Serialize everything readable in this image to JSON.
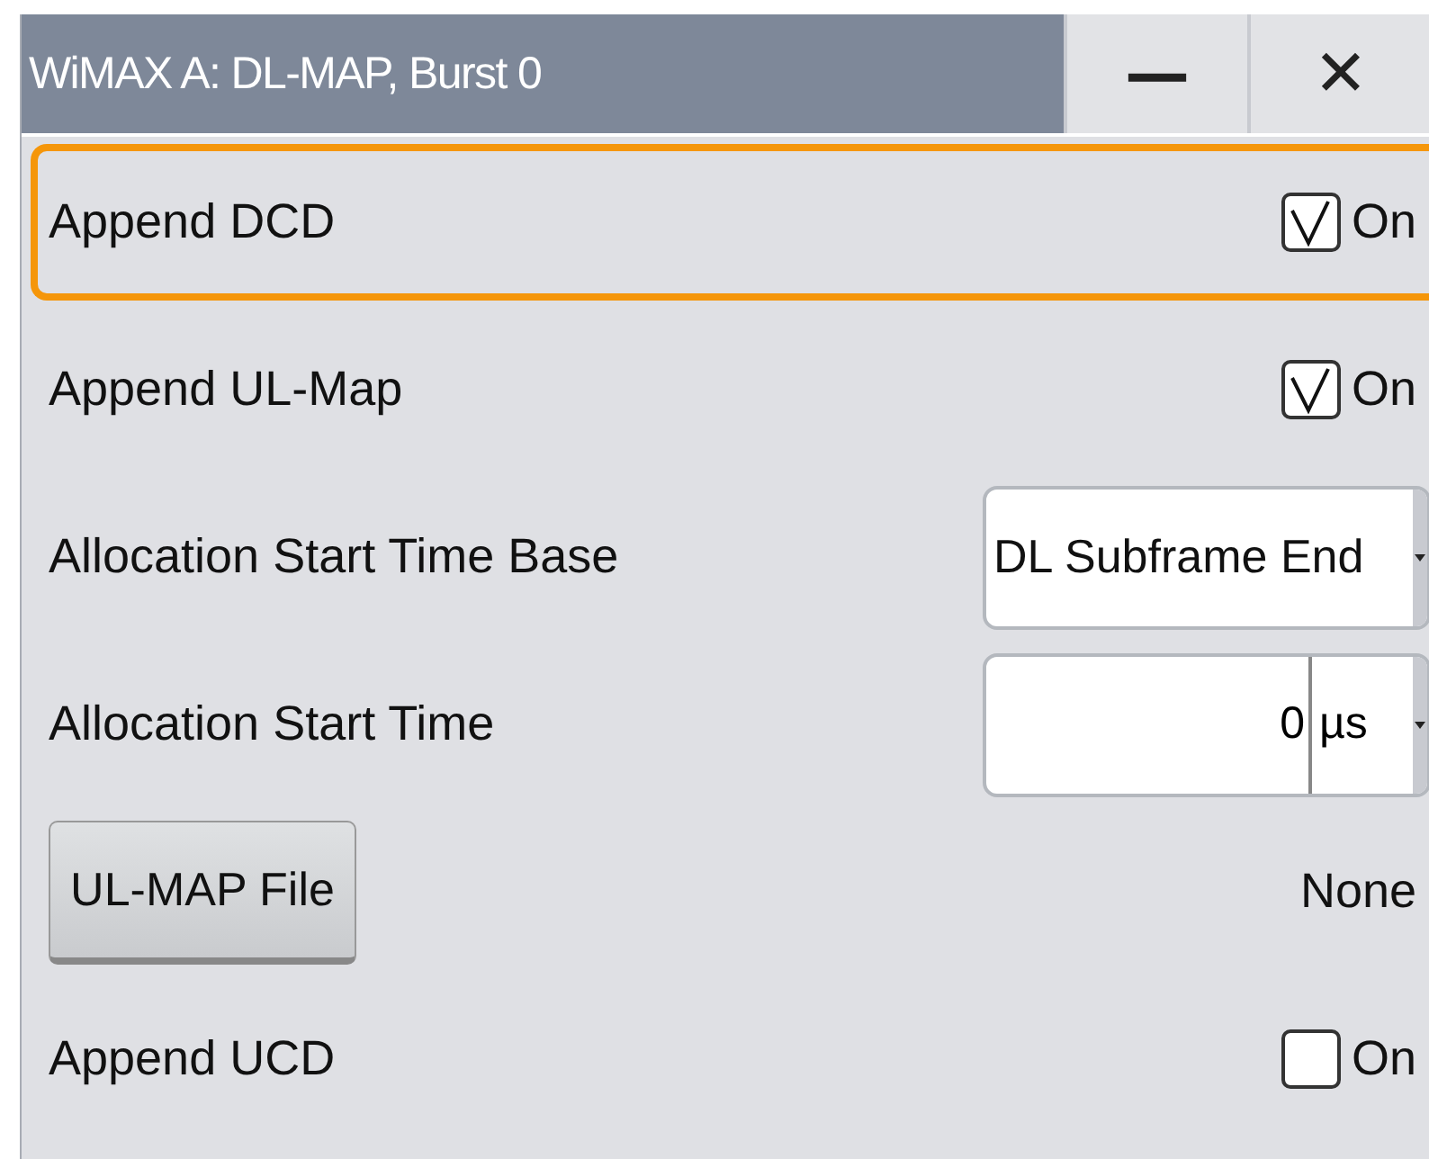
{
  "window": {
    "title": "WiMAX A: DL-MAP, Burst 0",
    "minimize": "—",
    "close": "✕"
  },
  "rows": [
    {
      "kind": "checkbox",
      "label": "Append DCD",
      "checked": true,
      "value": "On",
      "focused": true
    },
    {
      "kind": "checkbox",
      "label": "Append UL-Map",
      "checked": true,
      "value": "On",
      "focused": false
    },
    {
      "kind": "dropdown",
      "label": "Allocation Start Time Base",
      "value": "DL Subframe End",
      "focused": false
    },
    {
      "kind": "number",
      "label": "Allocation Start Time",
      "value": "0",
      "unit": "µs",
      "focused": false
    },
    {
      "kind": "button",
      "label": "UL-MAP File",
      "value": "None",
      "focused": false
    },
    {
      "kind": "checkbox",
      "label": "Append UCD",
      "checked": false,
      "value": "On",
      "focused": false
    }
  ]
}
